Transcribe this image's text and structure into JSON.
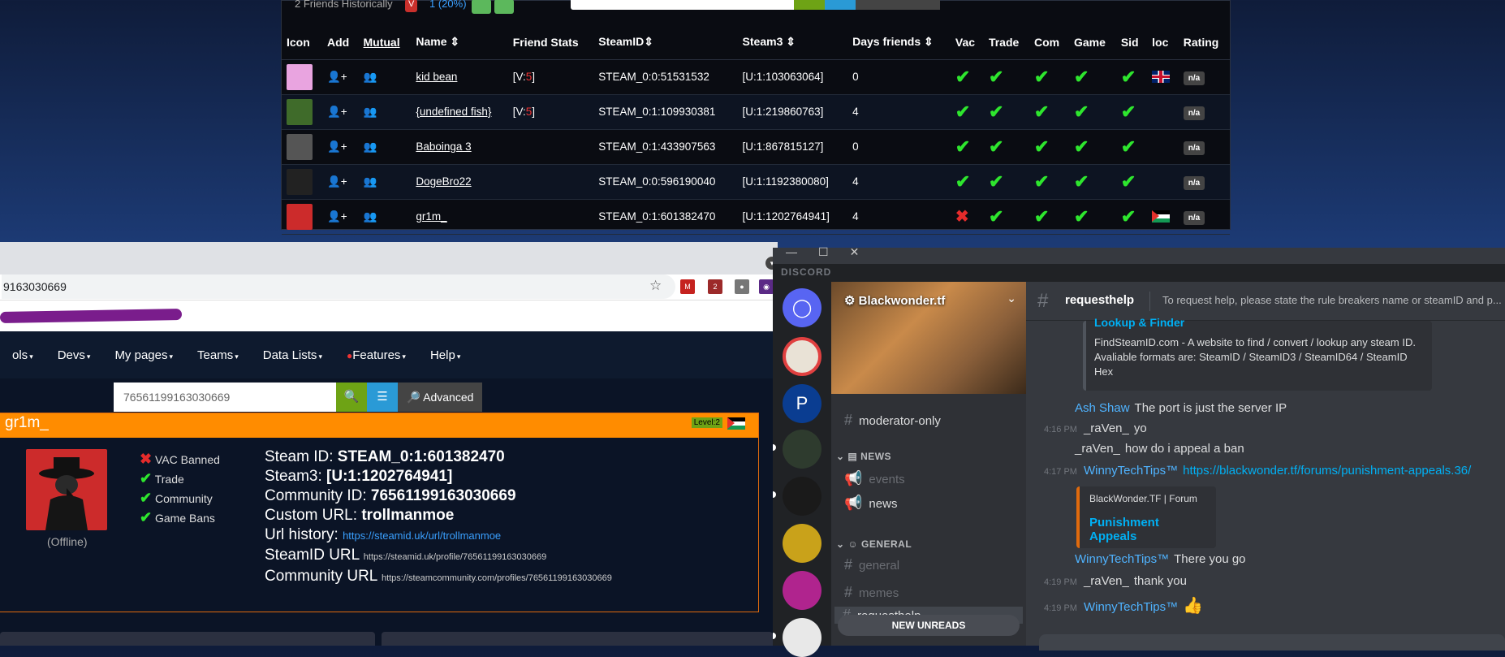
{
  "friends": {
    "header_text": "2 Friends Historically",
    "badge_red": "V",
    "badge_pct": "1 (20%)",
    "search_top_placeholder": "",
    "columns": [
      "Icon",
      "Add",
      "Mutual",
      "Name ⇕",
      "Friend Stats",
      "SteamID⇕",
      "Steam3 ⇕",
      "Days friends ⇕",
      "Vac",
      "Trade",
      "Com",
      "Game",
      "Sid",
      "loc",
      "Rating"
    ],
    "rows": [
      {
        "name": "kid bean",
        "stats_pre": "[V:",
        "stats_num": "5",
        "stats_post": "]",
        "steamid": "STEAM_0:0:51531532",
        "steam3": "[U:1:103063064]",
        "days": "0",
        "vac": "ok",
        "loc": "uk",
        "rating": "n/a",
        "avatar_color": "#e9a4e0"
      },
      {
        "name": "{undefined fish}",
        "stats_pre": "[V:",
        "stats_num": "5",
        "stats_post": "]",
        "steamid": "STEAM_0:1:109930381",
        "steam3": "[U:1:219860763]",
        "days": "4",
        "vac": "ok",
        "loc": "",
        "rating": "n/a",
        "avatar_color": "#3f6b2a"
      },
      {
        "name": "Baboinga 3",
        "stats_pre": "",
        "stats_num": "",
        "stats_post": "",
        "steamid": "STEAM_0:1:433907563",
        "steam3": "[U:1:867815127]",
        "days": "0",
        "vac": "ok",
        "loc": "",
        "rating": "n/a",
        "avatar_color": "#555"
      },
      {
        "name": "DogeBro22",
        "stats_pre": "",
        "stats_num": "",
        "stats_post": "",
        "steamid": "STEAM_0:0:596190040",
        "steam3": "[U:1:1192380080]",
        "days": "4",
        "vac": "ok",
        "loc": "",
        "rating": "n/a",
        "avatar_color": "#222"
      },
      {
        "name": "gr1m_",
        "stats_pre": "",
        "stats_num": "",
        "stats_post": "",
        "steamid": "STEAM_0:1:601382470",
        "steam3": "[U:1:1202764941]",
        "days": "4",
        "vac": "banned",
        "loc": "ps",
        "rating": "n/a",
        "avatar_color": "#cc2b2b"
      }
    ]
  },
  "browser": {
    "url_fragment": "9163030669",
    "nav": [
      "ols",
      "Devs",
      "My pages",
      "Teams",
      "Data Lists",
      "Features",
      "Help"
    ],
    "search_value": "76561199163030669",
    "advanced_label": "Advanced"
  },
  "profile": {
    "name": "gr1m_",
    "level": "Level:2",
    "offline": "(Offline)",
    "checks": [
      {
        "mark": "x",
        "label": "VAC Banned"
      },
      {
        "mark": "ok",
        "label": "Trade"
      },
      {
        "mark": "ok",
        "label": "Community"
      },
      {
        "mark": "ok",
        "label": "Game Bans"
      }
    ],
    "steam_id_label": "Steam ID:",
    "steam_id": "STEAM_0:1:601382470",
    "steam3_label": "Steam3:",
    "steam3": "[U:1:1202764941]",
    "community_id_label": "Community ID:",
    "community_id": "76561199163030669",
    "custom_url_label": "Custom URL:",
    "custom_url": "trollmanmoe",
    "url_history_label": "Url history:",
    "url_history": "https://steamid.uk/url/trollmanmoe",
    "steamid_url_label": "SteamID URL",
    "steamid_url": "https://steamid.uk/profile/76561199163030669",
    "community_url_label": "Community URL",
    "community_url": "https://steamcommunity.com/profiles/76561199163030669"
  },
  "discord": {
    "brand": "DISCORD",
    "server": "Blackwonder.tf",
    "channels": {
      "moderator": "moderator-only",
      "cat_news": "NEWS",
      "events": "events",
      "news": "news",
      "cat_general": "GENERAL",
      "general": "general",
      "memes": "memes",
      "requesthelp": "requesthelp",
      "new_unreads": "NEW UNREADS"
    },
    "chat": {
      "channel": "requesthelp",
      "topic": "To request help, please state the rule breakers name or steamID and p...",
      "embed1_title": "Lookup & Finder",
      "embed1_desc": "FindSteamID.com - A website to find / convert / lookup any steam ID. Avaliable formats are: SteamID / SteamID3 / SteamID64 / SteamID Hex",
      "m1_author": "Ash Shaw",
      "m1_text": "The port is just the server IP",
      "m2_time": "4:16 PM",
      "m2_author": "_raVen_",
      "m2_text": "yo",
      "m3_author": "_raVen_",
      "m3_text": "how do i appeal a ban",
      "m4_time": "4:17 PM",
      "m4_author": "WinnyTechTips™",
      "m4_link": "https://blackwonder.tf/forums/punishment-appeals.36/",
      "embed2_site": "BlackWonder.TF | Forum",
      "embed2_title": "Punishment Appeals",
      "m5_author": "WinnyTechTips™",
      "m5_text": "There you go",
      "m6_time": "4:19 PM",
      "m6_author": "_raVen_",
      "m6_text": "thank you",
      "m7_time": "4:19 PM",
      "m7_author": "WinnyTechTips™",
      "m7_text": "👍"
    }
  }
}
